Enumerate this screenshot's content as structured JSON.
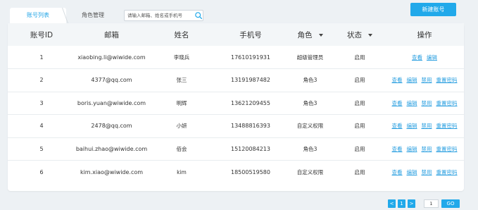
{
  "tabs": [
    {
      "label": "账号列表"
    },
    {
      "label": "角色管理"
    }
  ],
  "search": {
    "placeholder": "请输入邮箱、姓名或手机号",
    "value": ""
  },
  "new_button": "新建账号",
  "table": {
    "headers": {
      "id": "账号ID",
      "email": "邮箱",
      "name": "姓名",
      "phone": "手机号",
      "role": "角色",
      "status": "状态",
      "actions": "操作"
    },
    "rows": [
      {
        "id": "1",
        "email": "xiaobing.li@wiwide.com",
        "name": "李晓兵",
        "phone": "17610191931",
        "role": "超级管理员",
        "status": "启用",
        "actions": [
          "查看",
          "编辑"
        ]
      },
      {
        "id": "2",
        "email": "4377@qq.com",
        "name": "张三",
        "phone": "13191987482",
        "role": "角色3",
        "status": "启用",
        "actions": [
          "查看",
          "编辑",
          "禁用",
          "重置密码"
        ]
      },
      {
        "id": "3",
        "email": "boris.yuan@wiwide.com",
        "name": "明辉",
        "phone": "13621209455",
        "role": "角色3",
        "status": "启用",
        "actions": [
          "查看",
          "编辑",
          "禁用",
          "重置密码"
        ]
      },
      {
        "id": "4",
        "email": "2478@qq.com",
        "name": "小妍",
        "phone": "13488816393",
        "role": "自定义权限",
        "status": "启用",
        "actions": [
          "查看",
          "编辑",
          "禁用",
          "重置密码"
        ]
      },
      {
        "id": "5",
        "email": "baihui.zhao@wiwide.com",
        "name": "佰会",
        "phone": "15120084213",
        "role": "角色3",
        "status": "启用",
        "actions": [
          "查看",
          "编辑",
          "禁用",
          "重置密码"
        ]
      },
      {
        "id": "6",
        "email": "kim.xiao@wiwide.com",
        "name": "kim",
        "phone": "18500519580",
        "role": "自定义权限",
        "status": "启用",
        "actions": [
          "查看",
          "编辑",
          "禁用",
          "重置密码"
        ]
      }
    ]
  },
  "pagination": {
    "prev": "<",
    "current_page": "1",
    "next": ">",
    "goto_value": "1",
    "go_label": "GO"
  },
  "colors": {
    "accent": "#21a9ea",
    "link": "#2a9fe0",
    "background": "#edf1f4"
  }
}
